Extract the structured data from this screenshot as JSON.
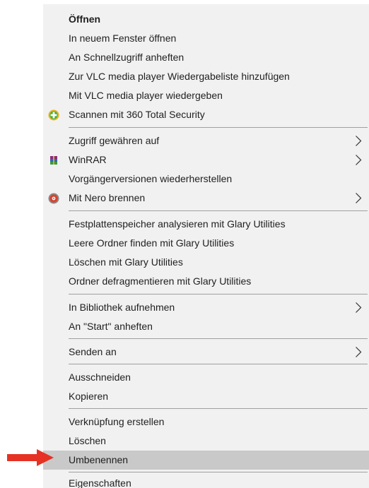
{
  "menu": {
    "items": [
      {
        "label": "Öffnen"
      },
      {
        "label": "In neuem Fenster öffnen"
      },
      {
        "label": "An Schnellzugriff anheften"
      },
      {
        "label": "Zur VLC media player Wiedergabeliste hinzufügen"
      },
      {
        "label": "Mit VLC media player wiedergeben"
      },
      {
        "label": "Scannen mit 360 Total Security",
        "icon": "360-total-security-icon"
      },
      {
        "label": "Zugriff gewähren auf"
      },
      {
        "label": "WinRAR",
        "icon": "winrar-icon"
      },
      {
        "label": "Vorgängerversionen wiederherstellen"
      },
      {
        "label": "Mit Nero brennen",
        "icon": "nero-icon"
      },
      {
        "label": "Festplattenspeicher analysieren mit Glary Utilities"
      },
      {
        "label": "Leere Ordner finden mit Glary Utilities"
      },
      {
        "label": "Löschen mit Glary Utilities"
      },
      {
        "label": "Ordner defragmentieren mit Glary Utilities"
      },
      {
        "label": "In Bibliothek aufnehmen"
      },
      {
        "label": "An \"Start\" anheften"
      },
      {
        "label": "Senden an"
      },
      {
        "label": "Ausschneiden"
      },
      {
        "label": "Kopieren"
      },
      {
        "label": "Verknüpfung erstellen"
      },
      {
        "label": "Löschen"
      },
      {
        "label": "Umbenennen"
      },
      {
        "label": "Eigenschaften"
      }
    ]
  },
  "highlighted_item": "Umbenennen",
  "colors": {
    "menu_background": "#f1f1f1",
    "highlight": "#c9c9c9",
    "separator": "#a0a0a0",
    "pointer_arrow": "#e53224"
  },
  "pointer": {
    "icon": "red-arrow-pointer-icon"
  }
}
